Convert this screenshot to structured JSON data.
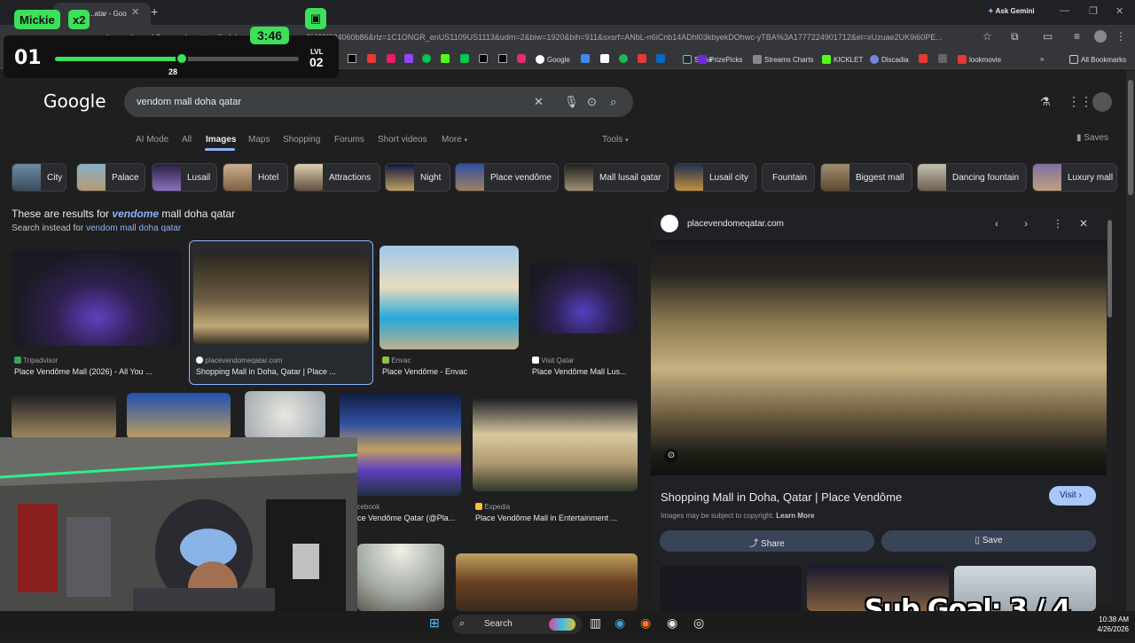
{
  "browser": {
    "tab_title": "...atar - Goo",
    "ask_gemini": "Ask Gemini",
    "url": "google.com/search?q=vendome+mall+doha+qatar&sca_esv=0f463f094060b86&rlz=1C1ONGR_enUS1109US1113&udm=2&biw=1920&bih=911&sxsrf=ANbL-n6iCnb14ADhl03kbyekDOhwc-yTBA%3A1777224901712&ei=xUzuae2UK9i60PE...",
    "bookmarks": [
      {
        "label": "Google",
        "color": "#4285f4"
      },
      {
        "label": "Stake",
        "color": "#1a2c38"
      },
      {
        "label": "PrizePicks",
        "color": "#6c2bd9"
      },
      {
        "label": "Streams Charts",
        "color": "#888888"
      },
      {
        "label": "KICKLET",
        "color": "#53fc18"
      },
      {
        "label": "Discadia",
        "color": "#7289da"
      },
      {
        "label": "lookmovie",
        "color": "#e53935"
      }
    ],
    "all_bookmarks": "All Bookmarks"
  },
  "google": {
    "logo": "Google",
    "query": "vendom mall doha qatar",
    "nav_tabs": [
      "AI Mode",
      "All",
      "Images",
      "Maps",
      "Shopping",
      "Forums",
      "Short videos",
      "More"
    ],
    "active_tab": "Images",
    "tools": "Tools",
    "saves": "Saves",
    "chips": [
      "City",
      "Palace",
      "Lusail",
      "Hotel",
      "Attractions",
      "Night",
      "Place vendôme",
      "Mall lusail qatar",
      "Lusail city",
      "Fountain",
      "Biggest mall",
      "Dancing fountain",
      "Luxury mall"
    ],
    "results_prefix": "These are results for",
    "results_bold": "vendome",
    "results_suffix": "mall doha qatar",
    "search_instead_prefix": "Search instead for",
    "search_instead_link": "vendom mall doha qatar"
  },
  "images": [
    {
      "source": "Tripadvisor",
      "title": "Place Vendôme Mall (2026) - All You ...",
      "src_color": "#34a853"
    },
    {
      "source": "placevendomeqatar.com",
      "title": "Shopping Mall in Doha, Qatar | Place ...",
      "src_color": "#ffffff"
    },
    {
      "source": "Envac",
      "title": "Place Vendôme - Envac",
      "src_color": "#8bc34a"
    },
    {
      "source": "Visit Qatar",
      "title": "Place Vendôme Mall Lus...",
      "src_color": "#ffffff"
    },
    {
      "source": "acebook",
      "title": "ace Vendôme Qatar (@Pla...",
      "src_color": "#1877f2"
    },
    {
      "source": "Expedia",
      "title": "Place Vendôme Mall in Entertainment ...",
      "src_color": "#fbc02d"
    }
  ],
  "panel": {
    "site": "placevendomeqatar.com",
    "title": "Shopping Mall in Doha, Qatar | Place Vendôme",
    "visit": "Visit",
    "copyright": "Images may be subject to copyright.",
    "learn_more": "Learn More",
    "share": "Share",
    "save": "Save"
  },
  "overlay": {
    "name": "Mickie",
    "multiplier": "x2",
    "timer": "3:46",
    "hud_number": "01",
    "progress_value": 28,
    "progress_fraction": 0.52,
    "level_label": "LVL",
    "level": "02",
    "sub_goal": "Sub Goal:  3 / 4"
  },
  "taskbar": {
    "search": "Search",
    "time": "10:38 AM",
    "date": "4/26/2026"
  }
}
